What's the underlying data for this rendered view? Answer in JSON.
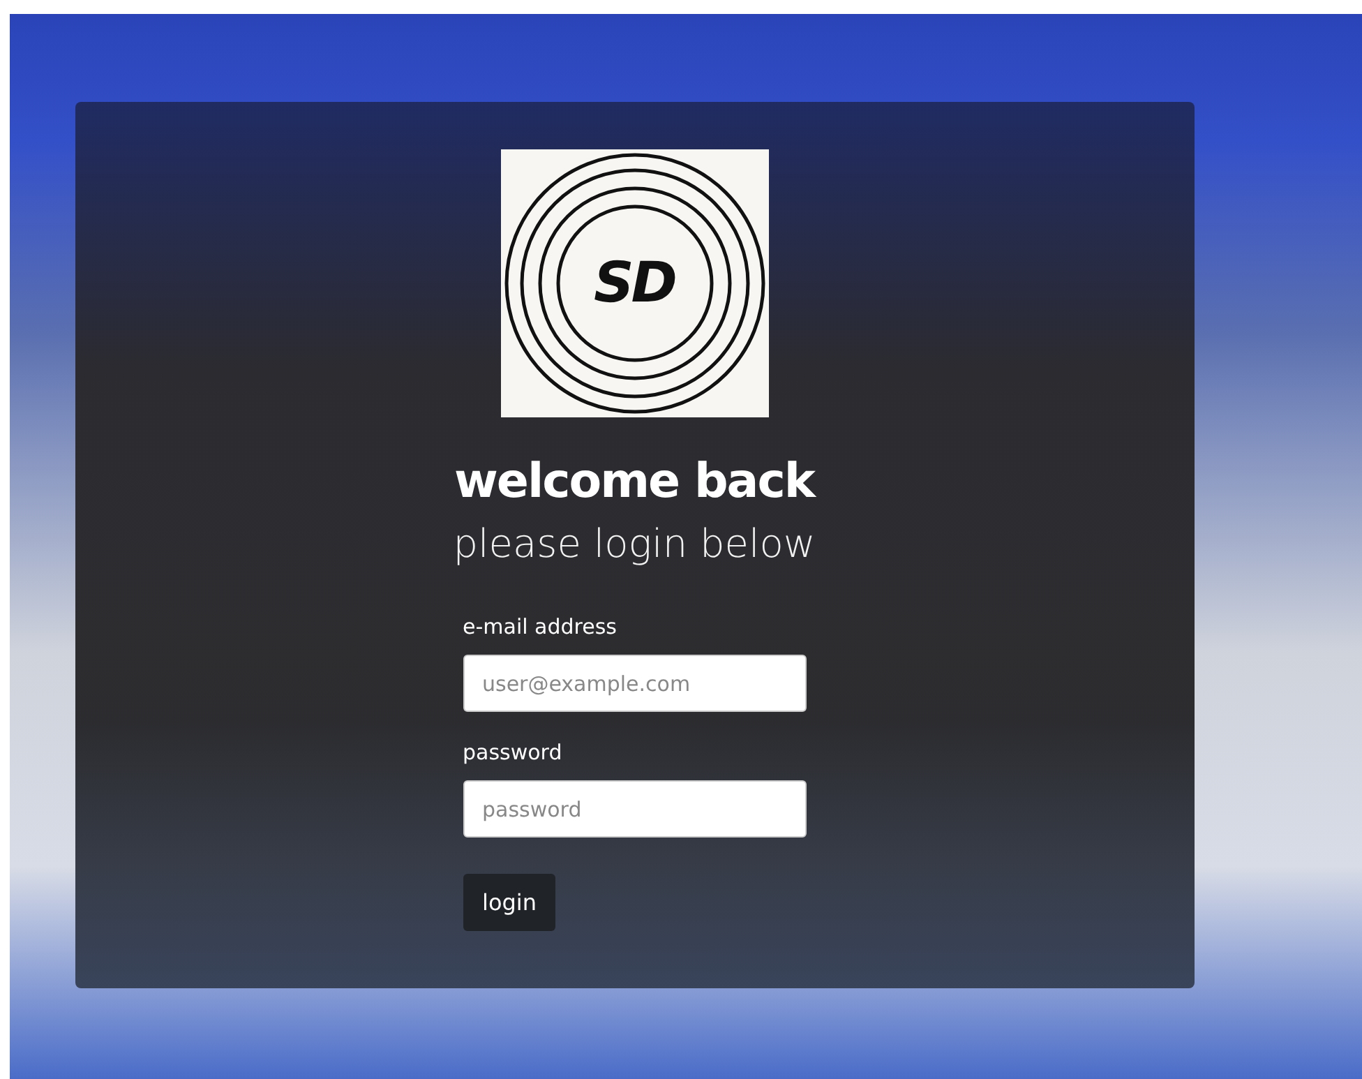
{
  "logo": {
    "text": "SD"
  },
  "heading": "welcome back",
  "subheading": "please login below",
  "fields": [
    {
      "label": "e-mail address",
      "placeholder": "user@example.com"
    },
    {
      "label": "password",
      "placeholder": "password"
    }
  ],
  "submit": {
    "label": "login"
  }
}
